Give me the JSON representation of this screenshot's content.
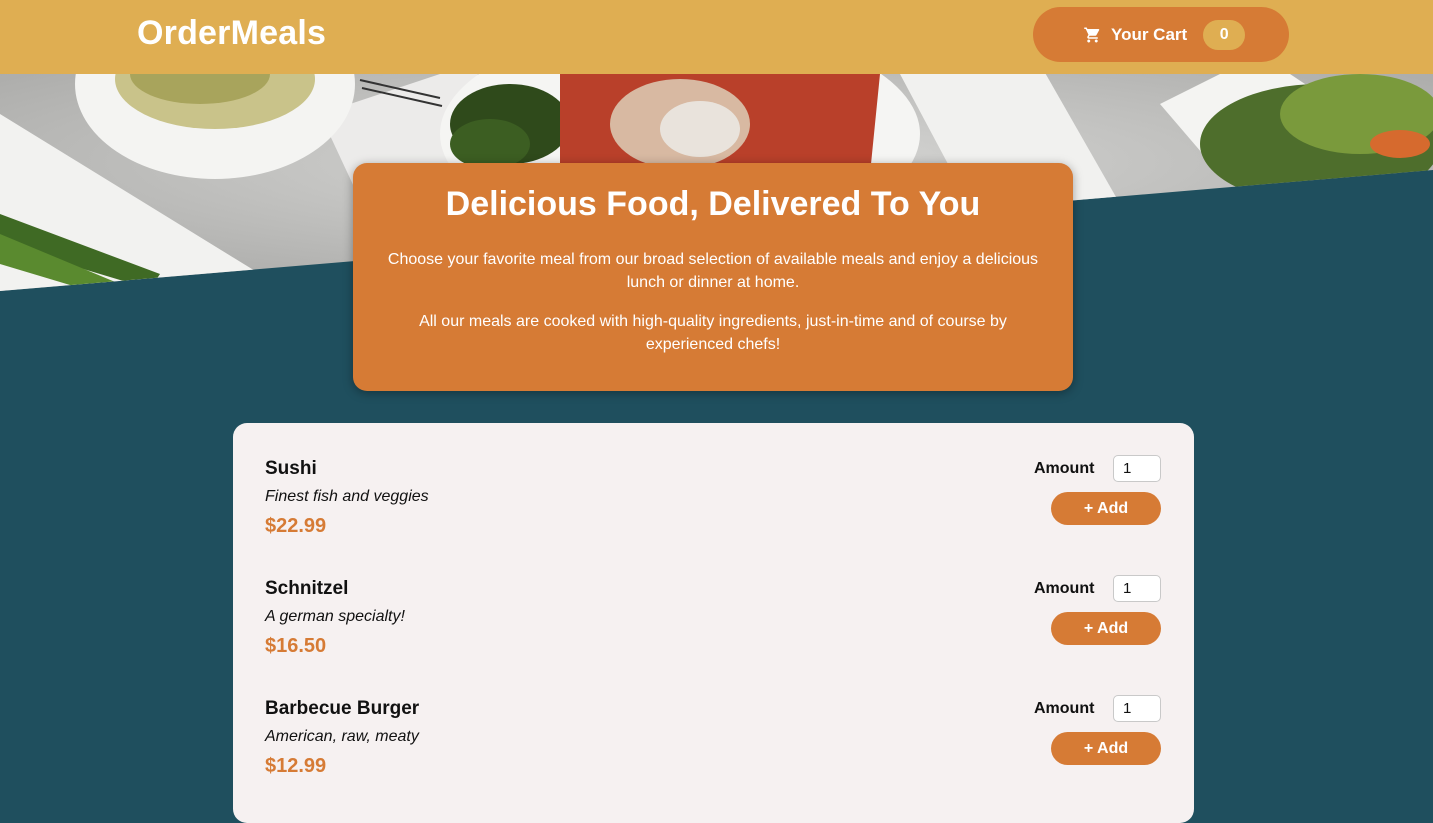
{
  "header": {
    "brand": "OrderMeals",
    "cart_label": "Your Cart",
    "cart_count": "0",
    "cart_icon": "shopping-cart-icon"
  },
  "summary": {
    "title": "Delicious Food, Delivered To You",
    "paragraph_1": "Choose your favorite meal from our broad selection of available meals and enjoy a delicious lunch or dinner at home.",
    "paragraph_2": "All our meals are cooked with high-quality ingredients, just-in-time and of course by experienced chefs!"
  },
  "meals": [
    {
      "name": "Sushi",
      "description": "Finest fish and veggies",
      "price": "$22.99",
      "amount_label": "Amount",
      "amount_value": "1",
      "add_label": "+ Add"
    },
    {
      "name": "Schnitzel",
      "description": "A german specialty!",
      "price": "$16.50",
      "amount_label": "Amount",
      "amount_value": "1",
      "add_label": "+ Add"
    },
    {
      "name": "Barbecue Burger",
      "description": "American, raw, meaty",
      "price": "$12.99",
      "amount_label": "Amount",
      "amount_value": "1",
      "add_label": "+ Add"
    }
  ],
  "colors": {
    "header": "#dfae52",
    "accent": "#d67b35",
    "background": "#1f4f5e",
    "card": "#f6f1f1"
  }
}
